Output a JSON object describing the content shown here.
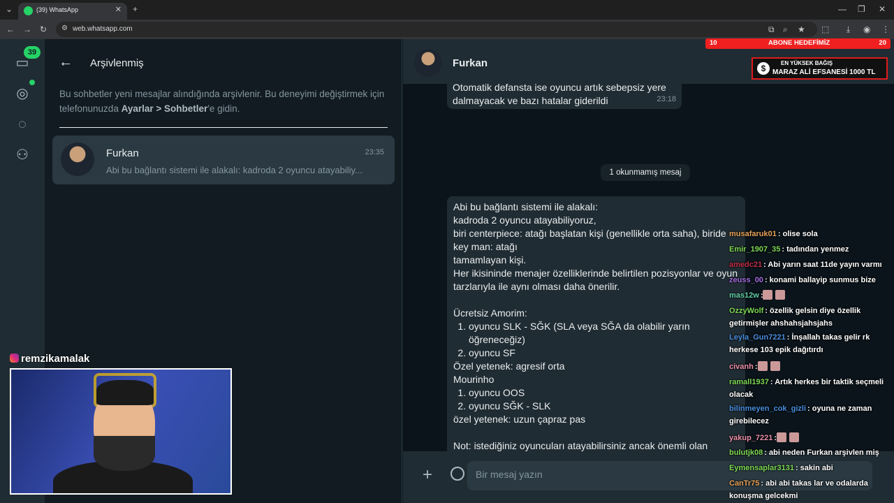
{
  "browser": {
    "tab_title": "(39) WhatsApp",
    "url": "web.whatsapp.com"
  },
  "navrail": {
    "unread_badge": "39"
  },
  "archived": {
    "title": "Arşivlenmiş",
    "info_part1": "Bu sohbetler yeni mesajlar alındığında arşivlenir. Bu deneyimi değiştirmek için telefonunuzda ",
    "info_bold": "Ayarlar > Sohbetler",
    "info_part2": "'e gidin.",
    "chat": {
      "name": "Furkan",
      "time": "23:35",
      "preview": "Abi bu bağlantı sistemi ile alakalı: kadroda 2 oyuncu atayabiliy..."
    }
  },
  "chat": {
    "header_name": "Furkan",
    "msg1_line1": "Otomatik defansta ise  oyuncu artık sebepsiz yere",
    "msg1_line2": "dalmayacak ve bazı hatalar giderildi",
    "msg1_time": "23:18",
    "unread": "1 okunmamış mesaj",
    "msg2": {
      "l1": "Abi bu bağlantı sistemi ile alakalı:",
      "l2": "kadroda 2 oyuncu atayabiliyoruz,",
      "l3": "biri centerpiece: atağı başlatan kişi (genellikle orta saha), biride key man: atağı",
      "l4": "tamamlayan kişi.",
      "l5": "Her ikisininde menajer özelliklerinde belirtilen pozisyonlar ve oyun tarzlarıyla ile aynı olması daha önerilir.",
      "amorim_title": "Ücretsiz Amorim:",
      "amorim_1": "oyuncu SLK - SĞK (SLA veya SĞA da olabilir yarın öğreneceğiz)",
      "amorim_2": "oyuncu SF",
      "ozel1": "Özel yetenek: agresif orta",
      "mourinho": "Mourinho",
      "mour_1": "oyuncu OOS",
      "mour_2": "oyuncu SĞK - SLK",
      "ozel2": "özel yetenek: uzun çapraz pas",
      "note": "Not: istediğiniz oyuncuları atayabilirsiniz ancak önemli olan pozisyon ve oyun tarzı uyumudur."
    },
    "input_placeholder": "Bir mesaj yazın"
  },
  "overlay": {
    "goal_left": "10",
    "goal_label": "ABONE HEDEFİMİZ",
    "goal_right": "20",
    "donation_top": "EN YÜKSEK BAĞIŞ",
    "donation_main": "MARAZ ALİ EFSANESİ  1000 TL",
    "webcam_handle": "remzikamalak",
    "chat_messages": [
      {
        "user": "musafaruk01",
        "color": "#e8a35c",
        "text": ": olise sola"
      },
      {
        "user": "Emir_1907_35",
        "color": "#7ed957",
        "text": ": tadından yenmez"
      },
      {
        "user": "amedc21",
        "color": "#c0304a",
        "text": ": Abi yarın saat 11de yayın varmı"
      },
      {
        "user": "zeuss_00",
        "color": "#a56de2",
        "text": ": konami ballayip sunmus bize"
      },
      {
        "user": "mas12w",
        "color": "#5fd0a8",
        "text": ":"
      },
      {
        "user": "OzzyWolf",
        "color": "#7ed957",
        "text": ": özellik gelsin diye özellik getirmişler ahshahsjahsjahs"
      },
      {
        "user": "Leyla_Gun7221",
        "color": "#4a8fe0",
        "text": ": İnşallah takas gelir rk herkese 103 epik dağıtırdı"
      },
      {
        "user": "civanh",
        "color": "#e88fa8",
        "text": ":"
      },
      {
        "user": "ramall1937",
        "color": "#7ed957",
        "text": ": Artık herkes bir taktik seçmeli olacak"
      },
      {
        "user": "bilinmeyen_cok_gizli",
        "color": "#4a8fe0",
        "text": ": oyuna ne zaman girebilecez"
      },
      {
        "user": "yakup_7221",
        "color": "#e88fa8",
        "text": ":"
      },
      {
        "user": "bulutjk08",
        "color": "#7ed957",
        "text": ": abi neden Furkan arşivlen miş"
      },
      {
        "user": "Eymensaplar3131",
        "color": "#7ed957",
        "text": ": sakin abi"
      },
      {
        "user": "CanTr75",
        "color": "#e8a35c",
        "text": ": abi abi takas lar ve odalarda konuşma gelcekmi"
      }
    ]
  }
}
